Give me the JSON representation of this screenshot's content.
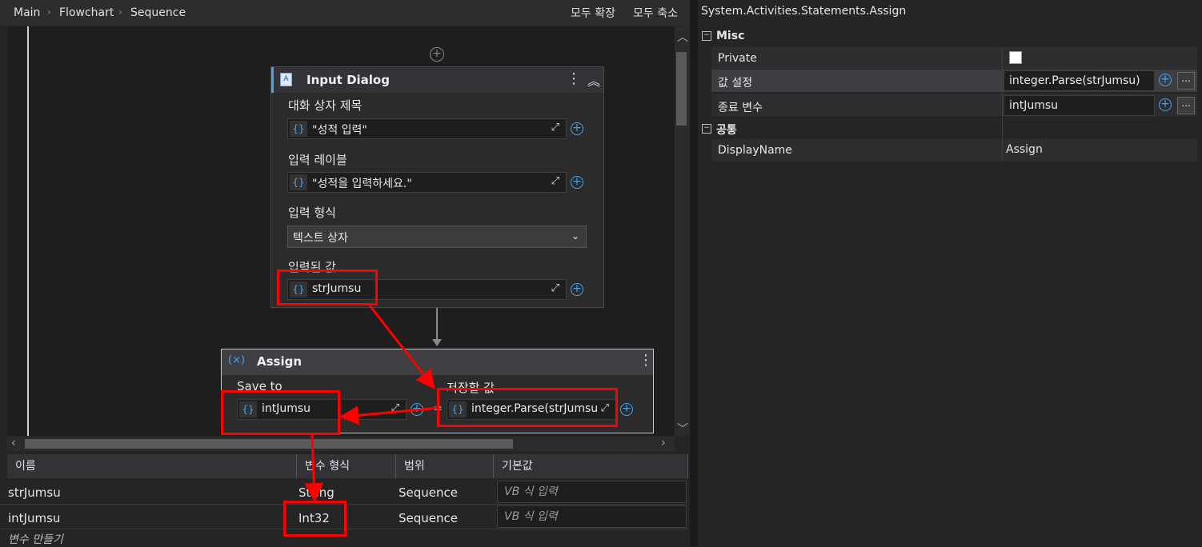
{
  "breadcrumb": {
    "items": [
      "Main",
      "Flowchart",
      "Sequence"
    ]
  },
  "toolbar": {
    "expand_all": "모두 확장",
    "collapse_all": "모두 축소"
  },
  "input_dialog": {
    "title": "Input Dialog",
    "fields": [
      {
        "label": "대화 상자 제목",
        "value": "\"성적 입력\""
      },
      {
        "label": "입력 레이블",
        "value": "\"성적을 입력하세요.\""
      }
    ],
    "format_label": "입력 형식",
    "format_value": "텍스트 상자",
    "result_label": "입력된 값",
    "result_value": "strJumsu"
  },
  "assign": {
    "title": "Assign",
    "save_to_label": "Save to",
    "save_to_value": "intJumsu",
    "value_label": "저장할 값",
    "value_value": "integer.Parse(strJumsu",
    "equals": "="
  },
  "variables": {
    "headers": [
      "이름",
      "변수 형식",
      "범위",
      "기본값"
    ],
    "rows": [
      {
        "name": "strJumsu",
        "type": "String",
        "scope": "Sequence",
        "default": "VB 식 입력"
      },
      {
        "name": "intJumsu",
        "type": "Int32",
        "scope": "Sequence",
        "default": "VB 식 입력"
      }
    ],
    "create": "변수 만들기"
  },
  "properties": {
    "title": "System.Activities.Statements.Assign",
    "misc": {
      "label": "Misc",
      "rows": [
        {
          "name": "Private",
          "value": ""
        },
        {
          "name": "값 설정",
          "value": "integer.Parse(strJumsu)"
        },
        {
          "name": "종료 변수",
          "value": "intJumsu"
        }
      ]
    },
    "common": {
      "label": "공통",
      "rows": [
        {
          "name": "DisplayName",
          "value": "Assign"
        }
      ]
    },
    "dots_label": "..."
  },
  "colors": {
    "accent": "#4aa3e8",
    "annotation": "#ff0000",
    "background": "#252526",
    "canvas": "#1e1e1e"
  }
}
